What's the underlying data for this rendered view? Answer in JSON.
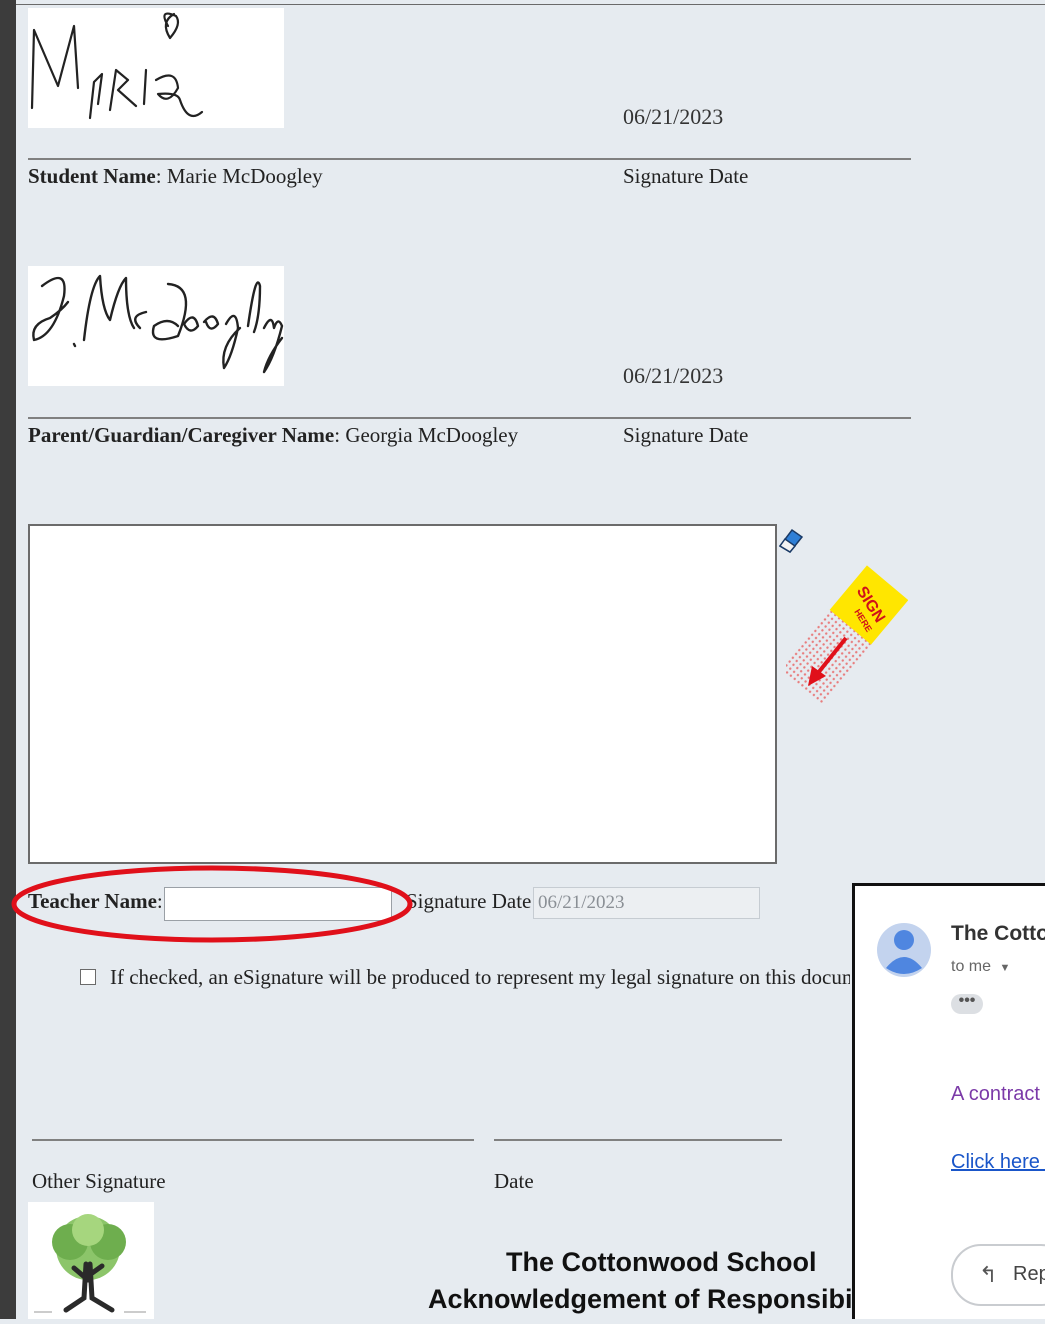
{
  "student": {
    "signature_text": "MARIG",
    "date": "06/21/2023",
    "name_label": "Student Name",
    "name_value": "Marie McDoogley",
    "date_label": "Signature Date"
  },
  "parent": {
    "signature_text": "G. McDoogley",
    "date": "06/21/2023",
    "name_label": "Parent/Guardian/Caregiver Name",
    "name_value": "Georgia McDoogley",
    "date_label": "Signature Date"
  },
  "teacher": {
    "name_label": "Teacher Name",
    "name_value": "",
    "date_label": "Signature Date",
    "date_value": "06/21/2023"
  },
  "sign_badge": {
    "label": "SIGN HERE"
  },
  "esign_checkbox": {
    "checked": false,
    "label": "If checked, an eSignature will be produced to represent my legal signature on this docume"
  },
  "other": {
    "signature_label": "Other Signature",
    "date_label": "Date"
  },
  "footer": {
    "school_name": "The Cottonwood School",
    "document_title": "Acknowledgement of Responsibilities"
  },
  "email": {
    "sender": "The Cotton",
    "to_line": "to me",
    "body_text": "A contract ha",
    "link_text": "Click here to",
    "reply_label": "Repl"
  },
  "colors": {
    "page_background": "#e6ebf0",
    "annotation_circle": "#e0101a",
    "badge_yellow": "#ffe600",
    "link_blue": "#1a56c9",
    "email_text_purple": "#7b3aa8"
  }
}
